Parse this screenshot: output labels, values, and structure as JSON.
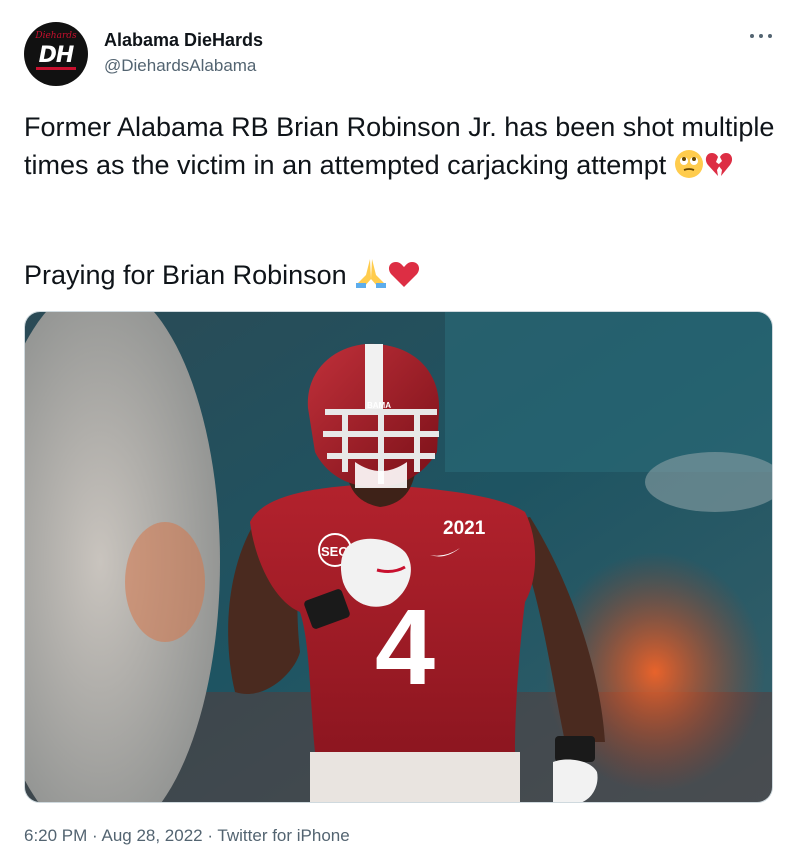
{
  "account": {
    "display_name": "Alabama DieHards",
    "handle": "@DiehardsAlabama",
    "avatar_initials": "DH"
  },
  "tweet": {
    "paragraph1": "Former Alabama RB Brian Robinson Jr. has been shot multiple times as the victim in an attempted carjacking attempt",
    "paragraph2": "Praying for Brian Robinson",
    "media": {
      "jersey_number": "4",
      "patch": "2021",
      "sec_logo": "SEC",
      "helmet_text": "BAMA"
    }
  },
  "meta": {
    "timestamp": "6:20 PM · Aug 28, 2022 · Twitter for iPhone"
  },
  "icons": {
    "more": "more-dots-icon",
    "emoji1": "face-with-rolling-eyes",
    "emoji2": "broken-heart",
    "emoji3": "folded-hands",
    "emoji4": "red-heart"
  }
}
